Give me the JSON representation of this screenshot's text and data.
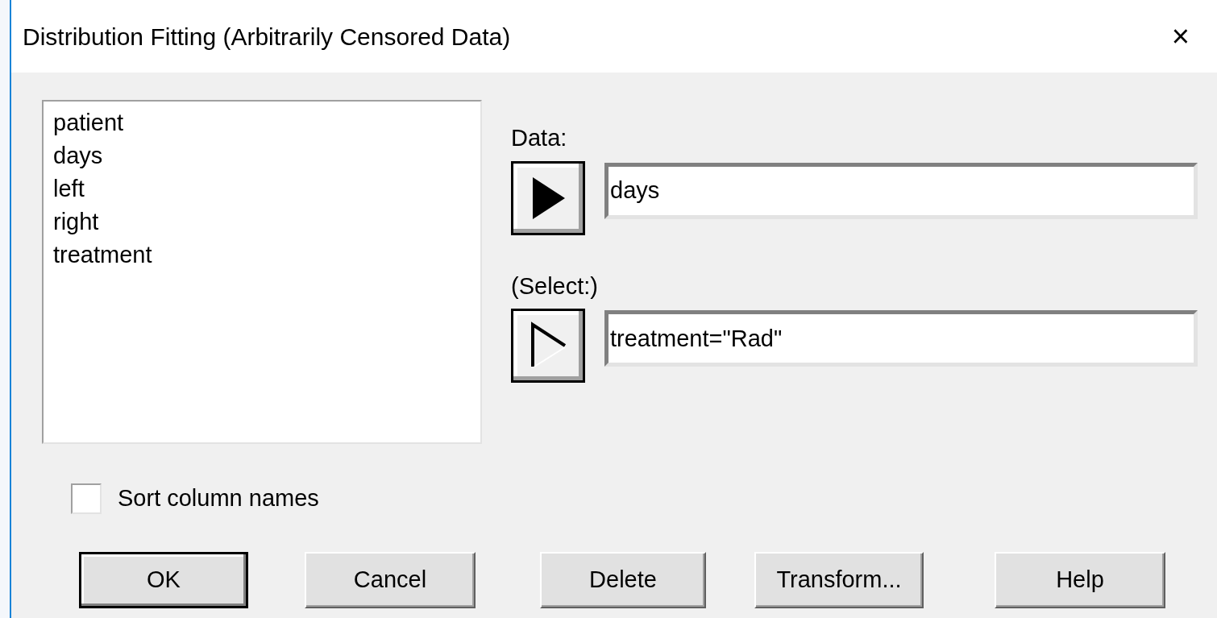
{
  "window": {
    "title": "Distribution Fitting (Arbitrarily Censored Data)",
    "close": "×"
  },
  "columns": [
    {
      "name": "patient",
      "selected": false
    },
    {
      "name": "days",
      "selected": false
    },
    {
      "name": "left",
      "selected": false
    },
    {
      "name": "right",
      "selected": false
    },
    {
      "name": "treatment",
      "selected": false
    }
  ],
  "targets": [
    {
      "label": "Data:",
      "kind": "filled",
      "value": "days"
    },
    {
      "label": "(Select:)",
      "kind": "hollow",
      "value": "treatment=\"Rad\""
    }
  ],
  "sort_column_names": {
    "label": "Sort column names",
    "checked": false
  },
  "buttons": [
    {
      "label": "OK",
      "default": true
    },
    {
      "label": "Cancel",
      "default": false
    },
    {
      "label": "Delete",
      "default": false
    },
    {
      "label": "Transform...",
      "default": false
    },
    {
      "label": "Help",
      "default": false
    }
  ]
}
